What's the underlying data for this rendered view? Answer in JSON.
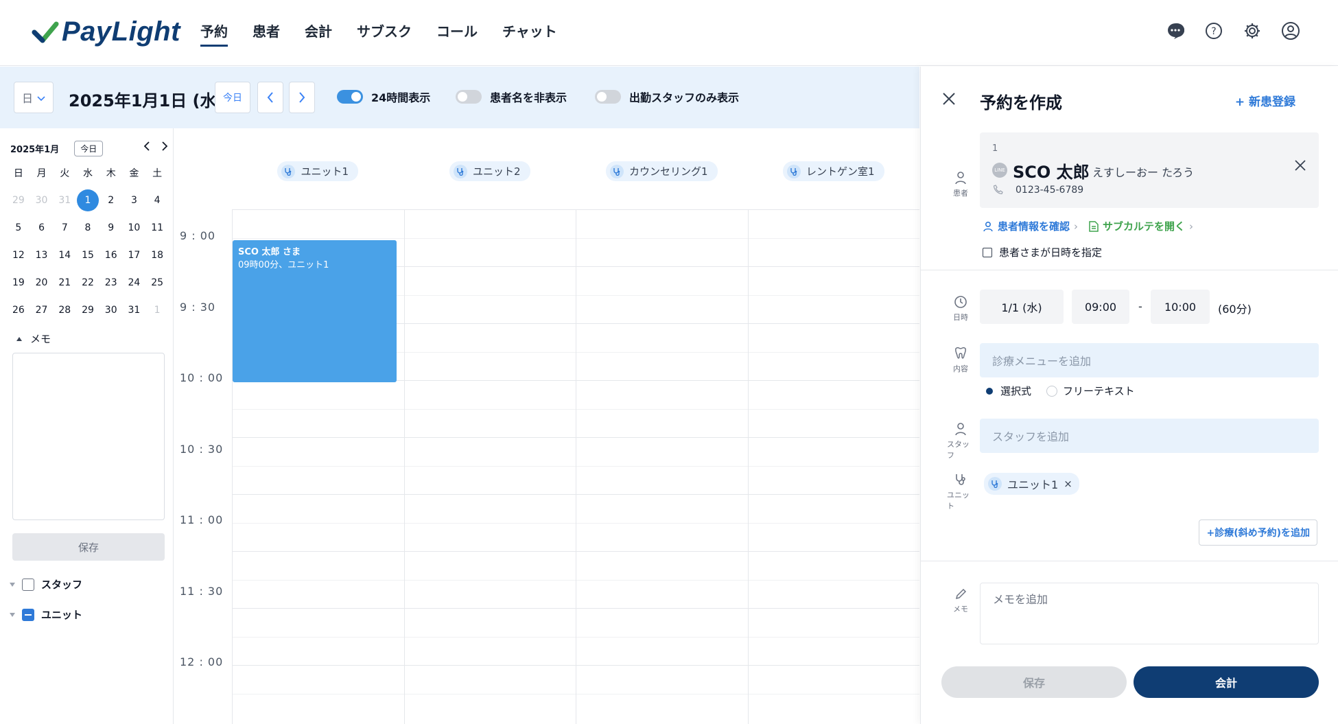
{
  "app": {
    "logo_text": "PayLight",
    "brand_color": "#0f3d73",
    "accent_color": "#2f8ae0"
  },
  "nav": {
    "items": [
      {
        "label": "予約",
        "active": true
      },
      {
        "label": "患者"
      },
      {
        "label": "会計"
      },
      {
        "label": "サブスク"
      },
      {
        "label": "コール"
      },
      {
        "label": "チャット"
      }
    ],
    "icons": [
      "chat-bubble-icon",
      "help-icon",
      "gear-icon",
      "user-account-icon"
    ]
  },
  "toolbar": {
    "view": "日",
    "date_title": "2025年1月1日 (水)",
    "today_label": "今日",
    "toggles": [
      {
        "label": "24時間表示",
        "on": true
      },
      {
        "label": "患者名を非表示",
        "on": false
      },
      {
        "label": "出勤スタッフのみ表示",
        "on": false
      }
    ]
  },
  "mini_calendar": {
    "month": "2025年1月",
    "today_label": "今日",
    "weekdays": [
      "日",
      "月",
      "火",
      "水",
      "木",
      "金",
      "土"
    ],
    "weeks": [
      [
        "29",
        "30",
        "31",
        "1",
        "2",
        "3",
        "4"
      ],
      [
        "5",
        "6",
        "7",
        "8",
        "9",
        "10",
        "11"
      ],
      [
        "12",
        "13",
        "14",
        "15",
        "16",
        "17",
        "18"
      ],
      [
        "19",
        "20",
        "21",
        "22",
        "23",
        "24",
        "25"
      ],
      [
        "26",
        "27",
        "28",
        "29",
        "30",
        "31",
        "1"
      ]
    ],
    "selected": "1"
  },
  "sidebar": {
    "memo_label": "メモ",
    "memo_save": "保存",
    "filters": [
      {
        "label": "スタッフ",
        "state": "unchecked"
      },
      {
        "label": "ユニット",
        "state": "indeterminate"
      }
    ]
  },
  "schedule": {
    "units": [
      "ユニット1",
      "ユニット2",
      "カウンセリング1",
      "レントゲン室1"
    ],
    "time_labels": [
      "9 : 00",
      "9 : 30",
      "10 : 00",
      "10 : 30",
      "11 : 00",
      "11 : 30",
      "12 : 00"
    ],
    "event": {
      "title": "SCO 太郎 さま",
      "subtitle": "09時00分、ユニット1"
    }
  },
  "panel": {
    "title": "予約を作成",
    "new_patient": "+ 新患登録",
    "patient": {
      "field_label": "患者",
      "id": "1",
      "name": "SCO 太郎",
      "kana": "えすしーおー たろう",
      "phone": "0123-45-6789",
      "badge": "LINE"
    },
    "links": {
      "info": "患者情報を確認",
      "subchart": "サブカルテを開く"
    },
    "patient_specified": "患者さまが日時を指定",
    "datetime": {
      "field_label": "日時",
      "date": "1/1 (水)",
      "start": "09:00",
      "sep": "-",
      "end": "10:00",
      "duration": "(60分)"
    },
    "content": {
      "field_label": "内容",
      "placeholder": "診療メニューを追加"
    },
    "mode": {
      "selected_label": "選択式",
      "free_label": "フリーテキスト"
    },
    "staff": {
      "field_label": "スタッフ",
      "placeholder": "スタッフを追加"
    },
    "unit": {
      "field_label": "ユニット",
      "tag": "ユニット1"
    },
    "add_diag": "+診療(斜め予約)を追加",
    "memo": {
      "field_label": "メモ",
      "placeholder": "メモを追加"
    },
    "save_btn": "保存",
    "pay_btn": "会計"
  }
}
